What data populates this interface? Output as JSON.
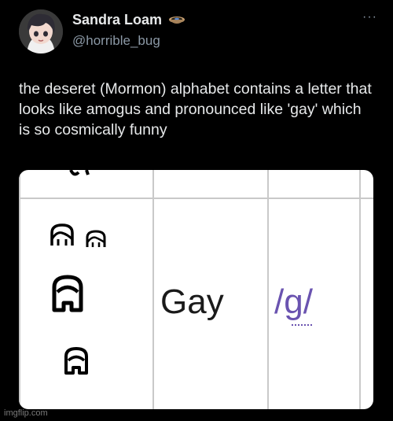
{
  "user": {
    "display_name": "Sandra Loam",
    "handle": "@horrible_bug",
    "avatar_icon": "avatar-illustration",
    "badge_icon": "bowl-emoji-icon"
  },
  "menu": {
    "more_icon": "more-options-icon",
    "more_glyph": "···"
  },
  "tweet": {
    "text": "the deseret (Mormon) alphabet contains a letter that looks like amogus and pronounced like 'gay' which is so cosmically funny"
  },
  "media": {
    "word": "Gay",
    "ipa": "/g/",
    "colors": {
      "ipa": "#6a53b0",
      "background": "#ffffff"
    }
  },
  "watermark": "imgflip.com"
}
